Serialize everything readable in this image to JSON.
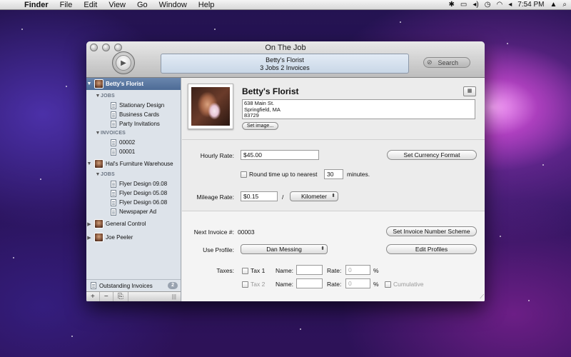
{
  "menubar": {
    "apple": "",
    "items": [
      "Finder",
      "File",
      "Edit",
      "View",
      "Go",
      "Window",
      "Help"
    ],
    "clock": "7:54 PM"
  },
  "window": {
    "title": "On The Job",
    "lcd": {
      "line1": "Betty's Florist",
      "line2": "3 Jobs  2 Invoices"
    },
    "search_placeholder": "Search"
  },
  "sidebar": {
    "clients": [
      {
        "name": "Betty's Florist",
        "selected": true,
        "jobs_header": "JOBS",
        "jobs": [
          "Stationary Design",
          "Business Cards",
          "Party Invitations"
        ],
        "invoices_header": "INVOICES",
        "invoices": [
          "00002",
          "00001"
        ]
      },
      {
        "name": "Hal's Furniture Warehouse",
        "jobs_header": "JOBS",
        "jobs": [
          "Flyer Design 09.08",
          "Flyer Design 05.08",
          "Flyer Design 06.08",
          "Newspaper Ad"
        ]
      },
      {
        "name": "General Control"
      },
      {
        "name": "Joe Peeler"
      }
    ],
    "outstanding": {
      "label": "Outstanding Invoices",
      "count": "2"
    },
    "toolbar": {
      "add": "+",
      "remove": "−",
      "new_job": "⎘",
      "grip": "|||"
    }
  },
  "client": {
    "name": "Betty's Florist",
    "address": [
      "638 Main St.",
      "Springfield, MA",
      "83729"
    ],
    "set_image": "Set image..."
  },
  "rates": {
    "hourly_label": "Hourly Rate:",
    "hourly_value": "$45.00",
    "currency_button": "Set Currency Format",
    "round_label": "Round time up to nearest",
    "round_value": "30",
    "round_unit": "minutes.",
    "mileage_label": "Mileage Rate:",
    "mileage_value": "$0.15",
    "slash": "/",
    "distance_unit": "Kilometer"
  },
  "invoice": {
    "next_label": "Next Invoice #:",
    "next_value": "00003",
    "scheme_button": "Set Invoice Number Scheme",
    "profile_label": "Use Profile:",
    "profile_value": "Dan Messing",
    "edit_profiles": "Edit Profiles",
    "taxes_label": "Taxes:",
    "tax1": {
      "label": "Tax 1",
      "name_label": "Name:",
      "rate_label": "Rate:",
      "rate_placeholder": "0",
      "percent": "%"
    },
    "tax2": {
      "label": "Tax 2",
      "name_label": "Name:",
      "rate_label": "Rate:",
      "rate_placeholder": "0",
      "percent": "%"
    },
    "cumulative": "Cumulative"
  }
}
